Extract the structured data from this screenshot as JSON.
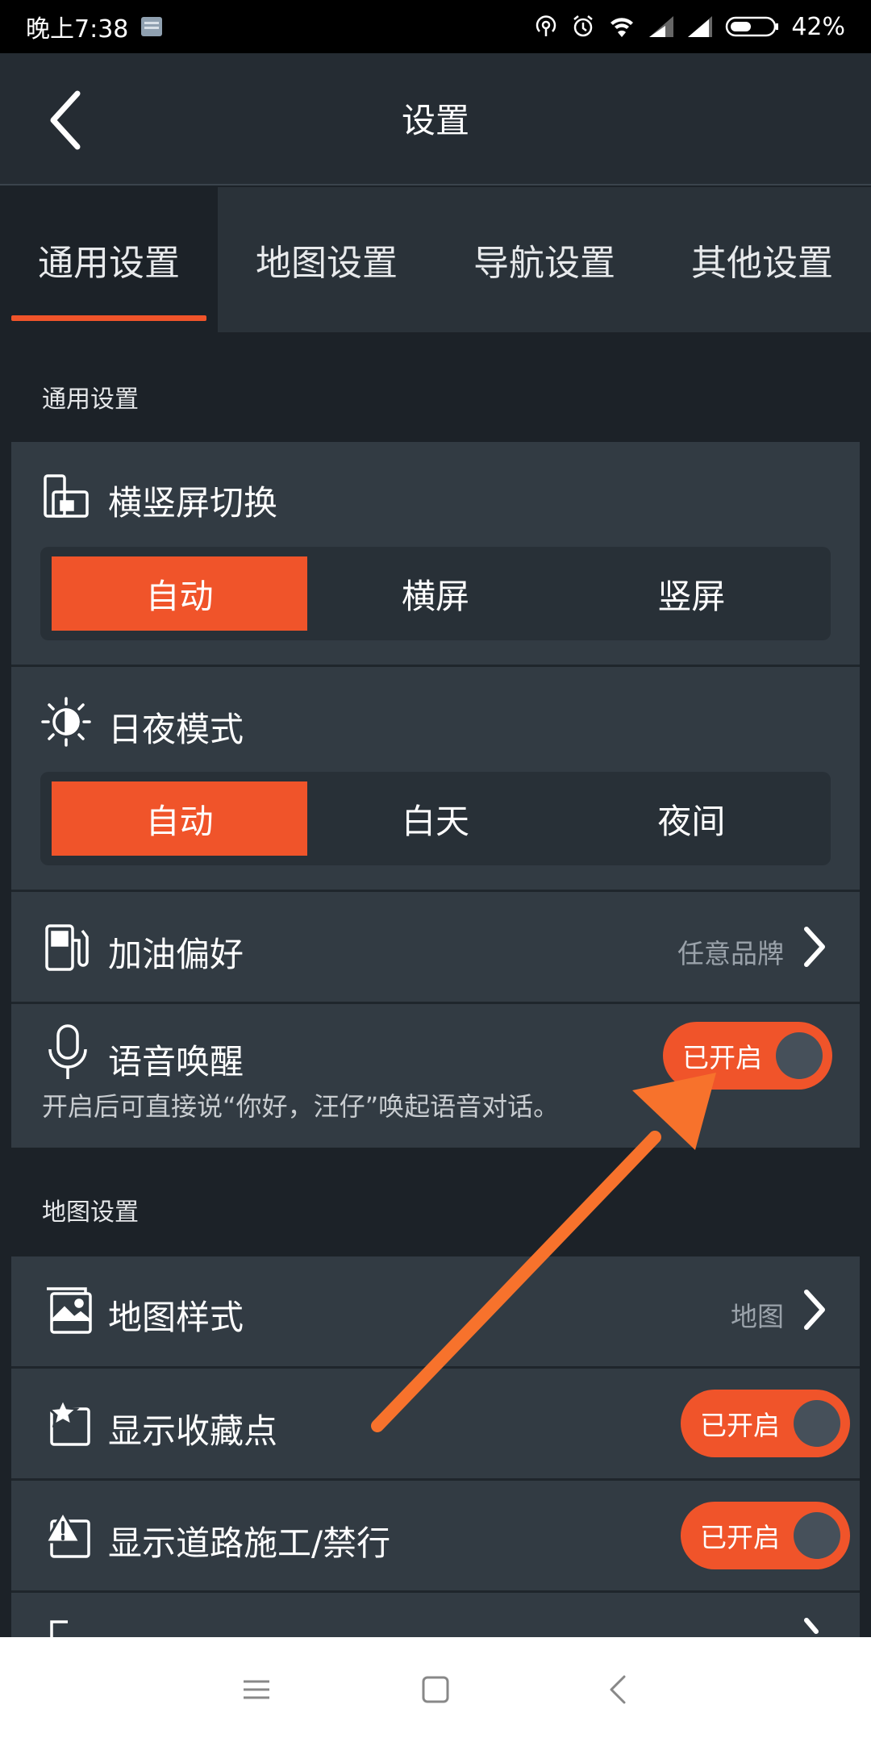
{
  "status_bar": {
    "time": "晚上7:38",
    "battery": "42%"
  },
  "header": {
    "title": "设置"
  },
  "tabs": [
    {
      "label": "通用设置",
      "active": true
    },
    {
      "label": "地图设置",
      "active": false
    },
    {
      "label": "导航设置",
      "active": false
    },
    {
      "label": "其他设置",
      "active": false
    }
  ],
  "general": {
    "section_title": "通用设置",
    "orientation": {
      "label": "横竖屏切换",
      "options": [
        "自动",
        "横屏",
        "竖屏"
      ],
      "selected": "自动"
    },
    "day_night": {
      "label": "日夜模式",
      "options": [
        "自动",
        "白天",
        "夜间"
      ],
      "selected": "自动"
    },
    "fuel": {
      "label": "加油偏好",
      "value": "任意品牌"
    },
    "voice_wake": {
      "label": "语音唤醒",
      "toggle": "已开启",
      "description": "开启后可直接说“你好，汪仔”唤起语音对话。"
    }
  },
  "map": {
    "section_title": "地图设置",
    "map_style": {
      "label": "地图样式",
      "value": "地图"
    },
    "show_favorites": {
      "label": "显示收藏点",
      "toggle": "已开启"
    },
    "show_construction": {
      "label": "显示道路施工/禁行",
      "toggle": "已开启"
    }
  },
  "colors": {
    "accent": "#f0542a",
    "annotation_arrow": "#f7722c",
    "background": "#1c2228",
    "card": "#323b43"
  }
}
